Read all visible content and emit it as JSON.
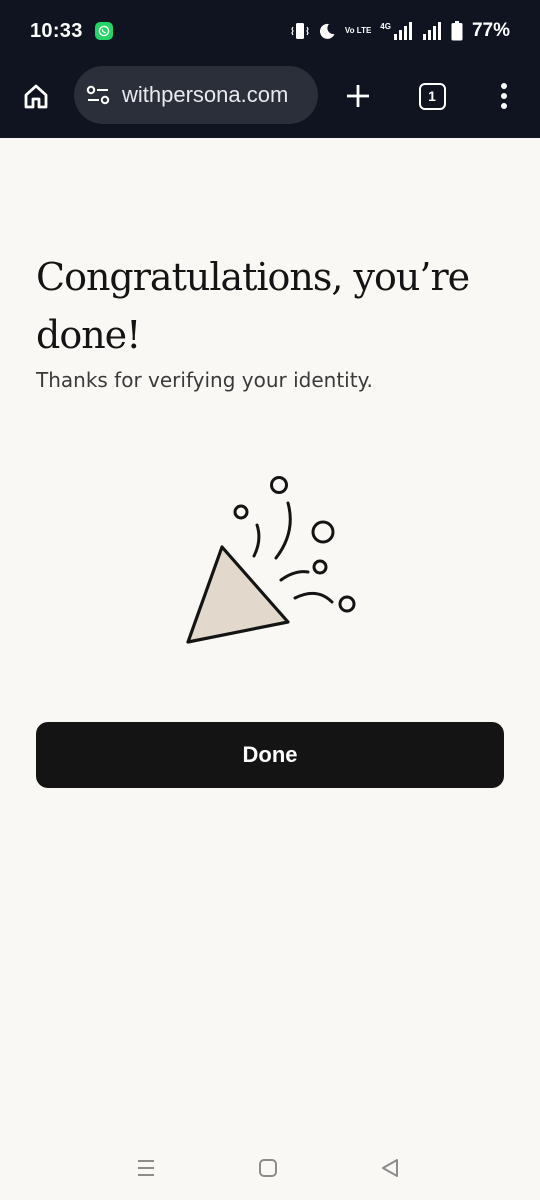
{
  "status_bar": {
    "time": "10:33",
    "notification_icon": "whatsapp-icon",
    "volte_label": "Vo LTE",
    "network_label": "4G",
    "battery_percent": "77%"
  },
  "browser": {
    "url": "withpersona.com",
    "tab_count": "1",
    "icons": [
      "home-icon",
      "site-settings-icon",
      "new-tab-icon",
      "tab-switcher-icon",
      "more-icon"
    ]
  },
  "content": {
    "title": "Congratulations, you’re done!",
    "subtitle": "Thanks for verifying your identity.",
    "illustration": "party-popper-icon",
    "done_label": "Done"
  },
  "nav": {
    "icons": [
      "recents-icon",
      "home-nav-icon",
      "back-icon"
    ]
  },
  "colors": {
    "page_background": "#f9f8f5",
    "toolbar_background": "#0f1420",
    "url_pill": "#2a2f3a",
    "button_background": "#141414",
    "cone_fill": "#e2d9cc"
  }
}
